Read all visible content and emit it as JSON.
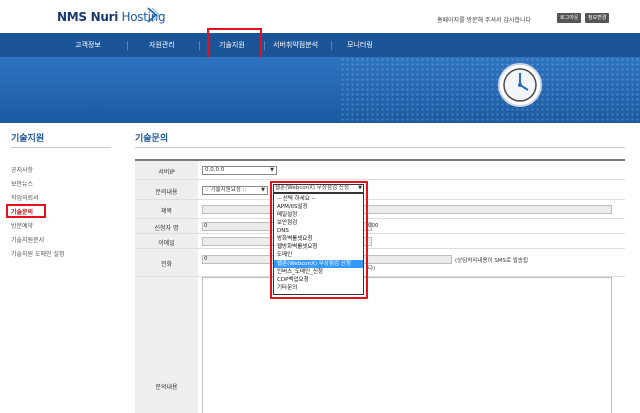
{
  "header": {
    "logo_bold": "NMS Nuri",
    "logo_light": " Hosting",
    "greeting": "홈페이지를 방문해 주셔서 감사합니다",
    "logout_label": "로그아웃",
    "info_label": "정보변경"
  },
  "nav": {
    "items": [
      "고객정보",
      "자원관리",
      "기술지원",
      "서버취약점분석",
      "모니터링"
    ]
  },
  "sidebar": {
    "title": "기술지원",
    "items": [
      "공지사항",
      "보안뉴스",
      "작업의뢰서",
      "기술문의",
      "방문예약",
      "기술지원문서",
      "기술지원 도메인 설정"
    ]
  },
  "content": {
    "title": "기술문의"
  },
  "form": {
    "server_ip_label": "서버IP",
    "server_ip_value": "0.0.0.0",
    "category_label": "문의내용",
    "category_value": ":: 기술지원요청 ::",
    "subject_label": "제목",
    "applicant_label": "신청자 명",
    "applicant_value": "0",
    "applicant_tail": "000",
    "email_label": "이메일",
    "phone_label": "전화",
    "phone_value": "0",
    "phone_tail": "다)",
    "sms_note": "(상담처리내용이 SMS로 발송됩",
    "body_label": "문의내용"
  },
  "dropdown": {
    "selected": "웹훈(WebconX) 무상점검 신청",
    "options": [
      "-- 선택 하세요 --",
      "APM/IIS설정",
      "메일설정",
      "보안점검",
      "DNS",
      "방화벽룰셋요청",
      "웹방화벽룰셋요청",
      "도메인",
      "웹훈(WebconX) 무상점검 신청",
      "인버스_도메인_신청",
      "CDP백업요청",
      "기타문의"
    ],
    "highlighted_index": 8
  },
  "colors": {
    "nav_bg": "#1b5597",
    "highlight": "#e8111b",
    "option_selected": "#3399ff"
  }
}
